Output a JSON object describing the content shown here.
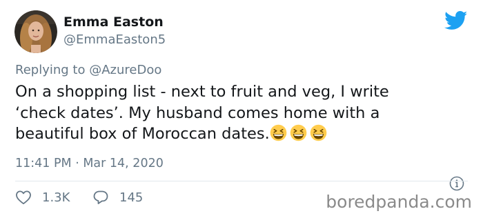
{
  "author": {
    "display_name": "Emma Easton",
    "handle": "@EmmaEaston5",
    "avatar": "profile photo"
  },
  "reply": {
    "prefix": "Replying to",
    "to": "@AzureDoo"
  },
  "tweet": {
    "lines": [
      "On a shopping list - next to fruit and veg, I write",
      "‘check dates’. My husband comes home with a",
      "beautiful box of Moroccan dates."
    ],
    "emoji": [
      "grinning-squinting-face-emoji",
      "grinning-squinting-face-emoji",
      "grinning-squinting-face-emoji"
    ]
  },
  "meta": {
    "timestamp": "11:41 PM · Mar 14, 2020"
  },
  "actions": {
    "likes": "1.3K",
    "replies": "145"
  },
  "watermark": "boredpanda.com",
  "colors": {
    "twitter_blue": "#1da1f2",
    "text": "#14171a",
    "muted": "#657786",
    "divider": "#e1e8ed",
    "emoji": "#ffcc4d"
  }
}
